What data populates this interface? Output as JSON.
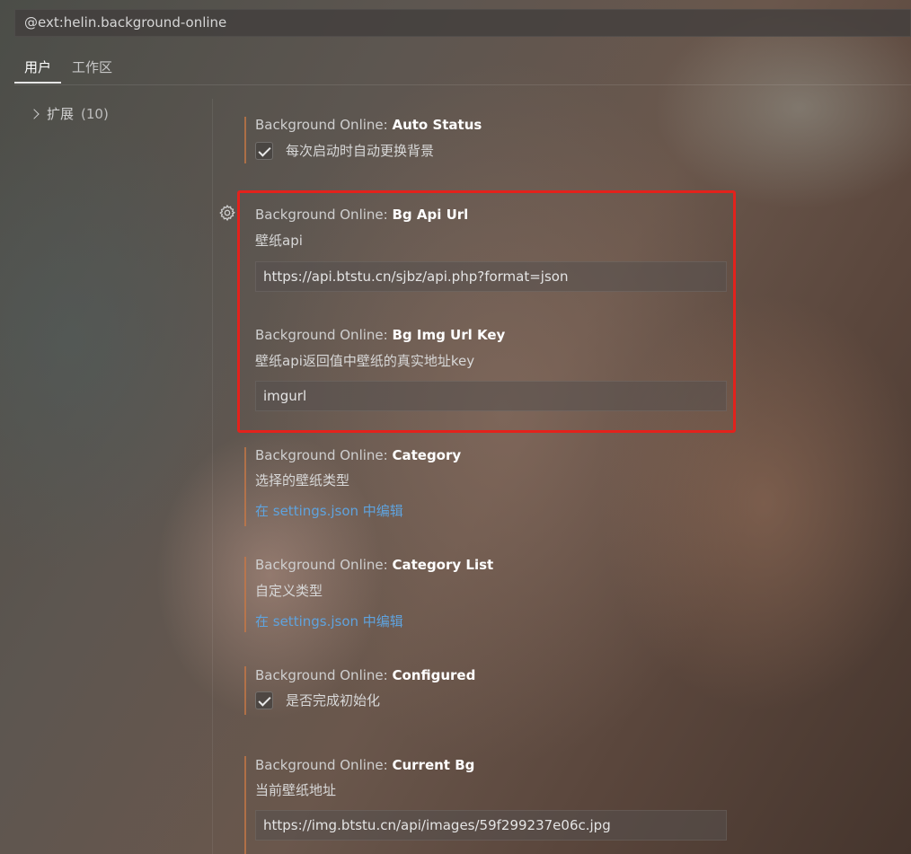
{
  "search": {
    "value": "@ext:helin.background-online"
  },
  "tabs": [
    {
      "label": "用户"
    },
    {
      "label": "工作区"
    }
  ],
  "tree": {
    "label": "扩展",
    "count": "(10)"
  },
  "settings": [
    {
      "category": "Background Online: ",
      "name": "Auto Status",
      "checkbox_label": "每次启动时自动更换背景",
      "checked": true
    },
    {
      "category": "Background Online: ",
      "name": "Bg Api Url",
      "description": "壁纸api",
      "value": "https://api.btstu.cn/sjbz/api.php?format=json"
    },
    {
      "category": "Background Online: ",
      "name": "Bg Img Url Key",
      "description": "壁纸api返回值中壁纸的真实地址key",
      "value": "imgurl"
    },
    {
      "category": "Background Online: ",
      "name": "Category",
      "description": "选择的壁纸类型",
      "link": "在 settings.json 中编辑"
    },
    {
      "category": "Background Online: ",
      "name": "Category List",
      "description": "自定义类型",
      "link": "在 settings.json 中编辑"
    },
    {
      "category": "Background Online: ",
      "name": "Configured",
      "checkbox_label": "是否完成初始化",
      "checked": true
    },
    {
      "category": "Background Online: ",
      "name": "Current Bg",
      "description": "当前壁纸地址",
      "value": "https://img.btstu.cn/api/images/59f299237e06c.jpg"
    }
  ],
  "colors": {
    "accent_link": "#5fa3de",
    "highlight_border": "#e3221c",
    "modified_bar": "#c87846"
  },
  "icons": {
    "gear": "gear-icon",
    "check": "checkmark-icon",
    "chevron": "chevron-right-icon"
  }
}
